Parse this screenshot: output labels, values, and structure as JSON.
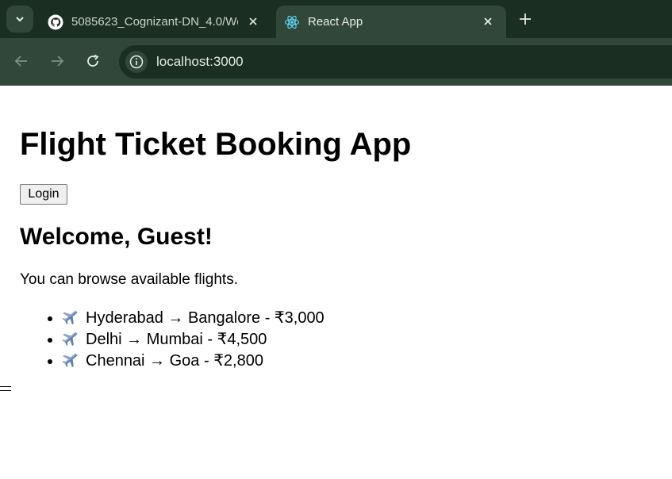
{
  "browser": {
    "tabs": [
      {
        "title": "5085623_Cognizant-DN_4.0/We",
        "icon": "github-icon",
        "active": false
      },
      {
        "title": "React App",
        "icon": "react-icon",
        "active": true
      }
    ],
    "address": "localhost:3000"
  },
  "page": {
    "title": "Flight Ticket Booking App",
    "login_label": "Login",
    "welcome": "Welcome, Guest!",
    "subtitle": "You can browse available flights.",
    "flights": [
      {
        "route": "Hyderabad → Bangalore - ₹3,000",
        "icon": "airplane-icon"
      },
      {
        "route": "Delhi → Mumbai - ₹4,500",
        "icon": "airplane-icon"
      },
      {
        "route": "Chennai → Goa - ₹2,800",
        "icon": "airplane-icon"
      }
    ]
  },
  "colors": {
    "tabbar_bg": "#1b2e22",
    "toolbar_bg": "#31473a",
    "page_bg": "#ffffff"
  }
}
